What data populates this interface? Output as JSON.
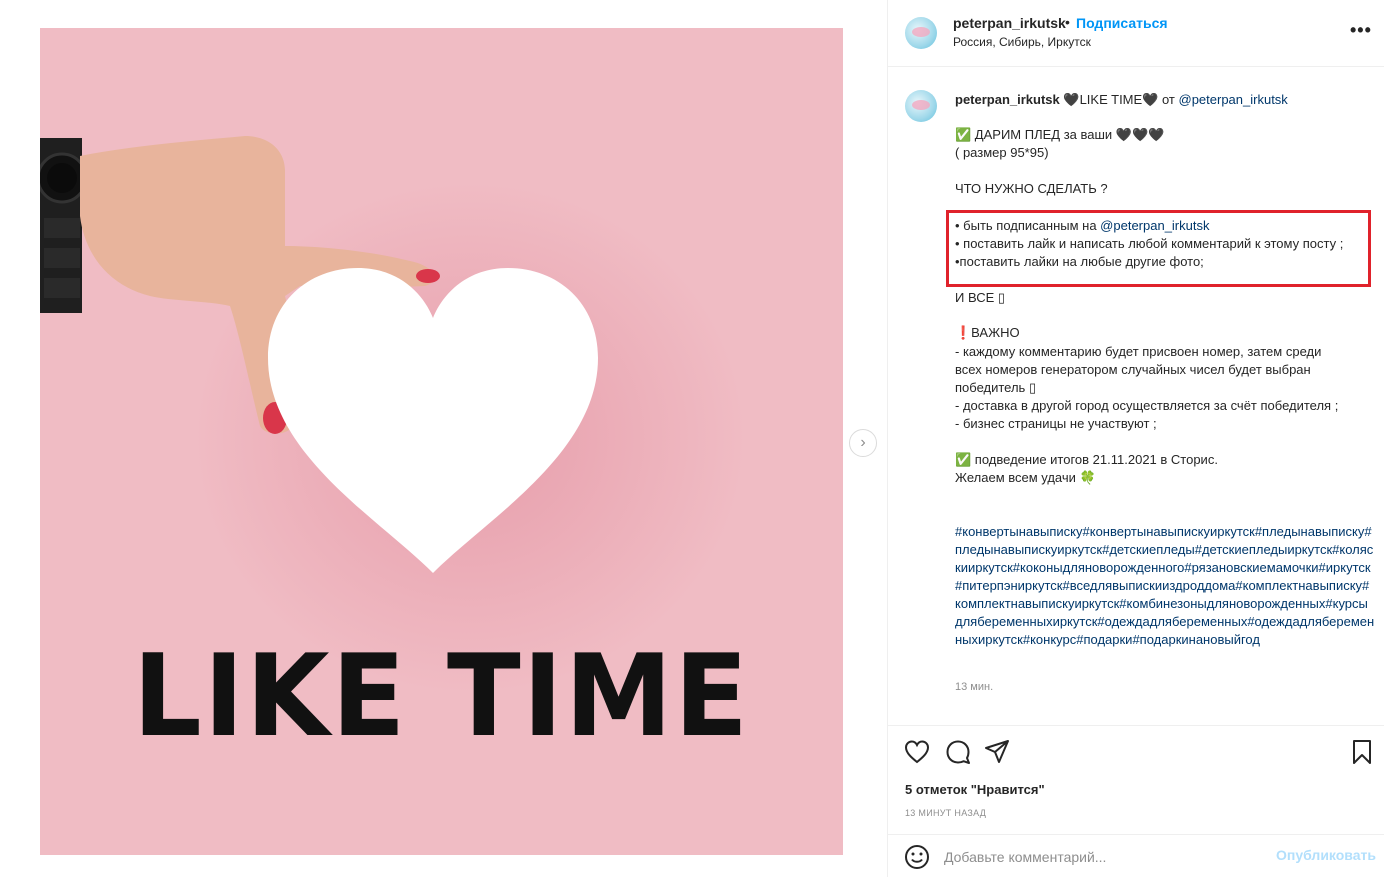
{
  "post": {
    "username": "peterpan_irkutsk",
    "dot": "•",
    "follow_label": "Подписаться",
    "location": "Россия, Сибирь, Иркутск",
    "more_label": "•••",
    "image_text": "LIKE TIME"
  },
  "caption": {
    "username": "peterpan_irkutsk",
    "title_text": " 🖤LIKE TIME🖤 от ",
    "title_mention": "@peterpan_irkutsk",
    "line1": "✅ ДАРИМ ПЛЕД за ваши 🖤🖤🖤",
    "line2": "( размер 95*95)",
    "line3": "ЧТО НУЖНО СДЕЛАТЬ ?",
    "rule1_prefix": "• быть подписанным на ",
    "rule1_mention": "@peterpan_irkutsk",
    "rule2": "• поставить лайк и написать любой комментарий к этому посту ;",
    "rule3": "•поставить лайки на любые другие фото;",
    "line4": "И ВСЕ ▯",
    "line5": "❗ВАЖНО",
    "line6": "- каждому комментарию будет присвоен номер, затем среди",
    "line7": "всех номеров генератором случайных чисел будет выбран",
    "line8": "победитель ▯",
    "line9": "- доставка в другой город осуществляется за счёт победителя ;",
    "line10": "- бизнес страницы не участвуют ;",
    "line11": "  ✅ подведение итогов 21.11.2021 в Сторис.",
    "line12": "Желаем всем удачи 🍀",
    "hashtags": "#конвертынавыписку#конвертынавыпискуиркутск#пледынавыписку#пледынавыпискуиркутск#детскиепледы#детскиепледыиркутск#коляскииркутск#коконыдляноворожденного#рязановскиемамочки#иркутск#питерпэниркутск#вседлявыпискииздроддома#комплектнавыписку#комплектнавыпискуиркутск#комбинезоныдляноворожденных#курсыдлябеременныхиркутск#одеждадлябеременных#одеждадлябеременныхиркутск#конкурс#подарки#подаркинановыйгод",
    "time_ago": "13 мин."
  },
  "actions": {
    "likes_text": "5 отметок \"Нравится\"",
    "post_time": "13 МИНУТ НАЗАД",
    "comment_placeholder": "Добавьте комментарий...",
    "publish_label": "Опубликовать"
  },
  "colors": {
    "accent": "#0095f6",
    "mention": "#00376b",
    "highlight_border": "#e0222b",
    "photo_bg": "#f0bcc4"
  }
}
